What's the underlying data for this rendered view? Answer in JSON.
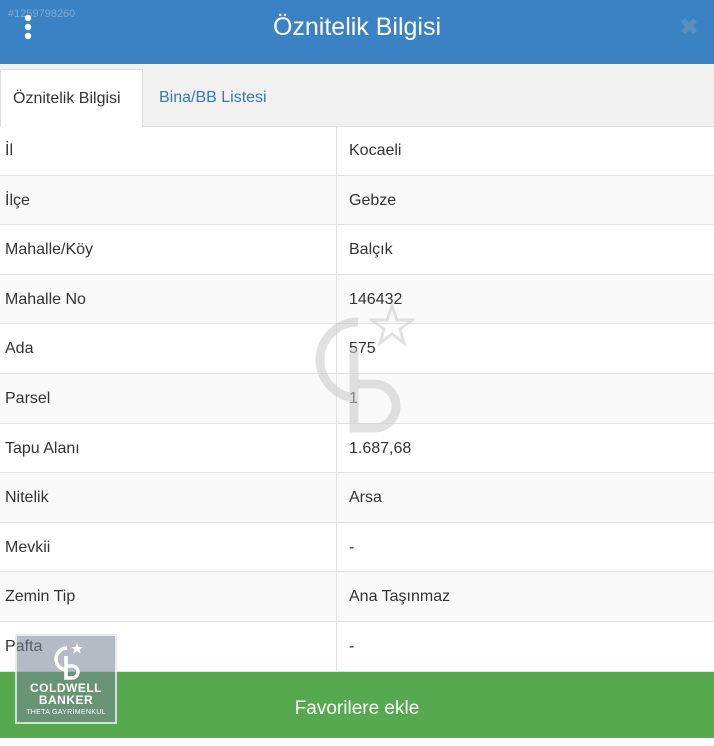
{
  "header": {
    "title": "Öznitelik Bilgisi",
    "watermark_id": "#1259798260",
    "close_symbol": "✖",
    "menu_icon": "kebab-menu-icon",
    "close_icon": "close-icon"
  },
  "tabs": [
    {
      "label": "Öznitelik Bilgisi",
      "active": true
    },
    {
      "label": "Bina/BB Listesi",
      "active": false
    }
  ],
  "rows": [
    {
      "key": "İl",
      "value": "Kocaeli"
    },
    {
      "key": "İlçe",
      "value": "Gebze"
    },
    {
      "key": "Mahalle/Köy",
      "value": "Balçık"
    },
    {
      "key": "Mahalle No",
      "value": "146432"
    },
    {
      "key": "Ada",
      "value": "575"
    },
    {
      "key": "Parsel",
      "value": "1"
    },
    {
      "key": "Tapu Alanı",
      "value": "1.687,68"
    },
    {
      "key": "Nitelik",
      "value": "Arsa"
    },
    {
      "key": "Mevkii",
      "value": "-"
    },
    {
      "key": "Zemin Tip",
      "value": "Ana Taşınmaz"
    },
    {
      "key": "Pafta",
      "value": "-"
    }
  ],
  "footer": {
    "label": "Favorilere ekle"
  },
  "brand": {
    "line1": "COLDWELL",
    "line2": "BANKER",
    "line3": "THETA GAYRİMENKUL"
  },
  "colors": {
    "header": "#3a82c4",
    "footer": "#56a94e",
    "tab_link": "#337ab7"
  }
}
